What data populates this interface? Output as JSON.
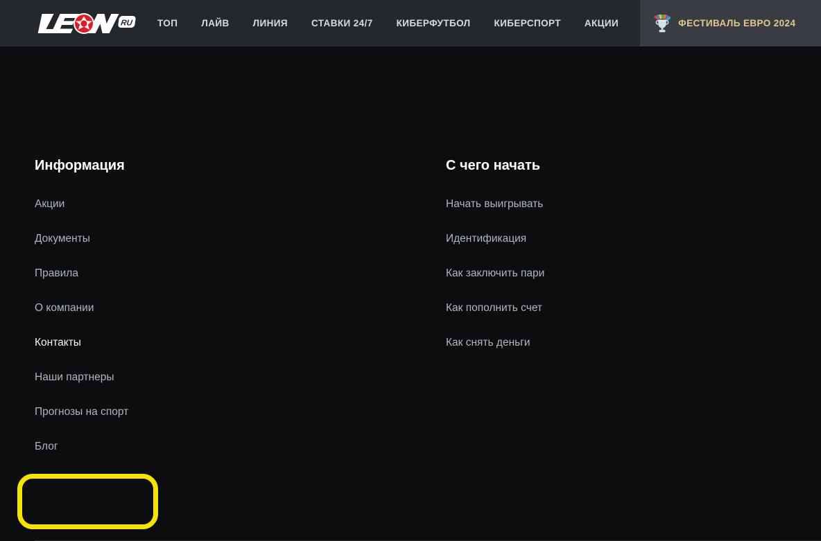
{
  "header": {
    "logo": {
      "name": "leon-ru-logo",
      "text": "LEON",
      "badge": "RU"
    },
    "nav_items": [
      {
        "label": "ТОП",
        "icon": null
      },
      {
        "label": "ЛАЙВ",
        "icon": null
      },
      {
        "label": "ЛИНИЯ",
        "icon": null
      },
      {
        "label": "СТАВКИ 24/7",
        "icon": null
      },
      {
        "label": "КИБЕРФУТБОЛ",
        "icon": null
      },
      {
        "label": "КИБЕРСПОРТ",
        "icon": null
      },
      {
        "label": "АКЦИИ",
        "icon": null
      },
      {
        "label": "ФЕСТИВАЛЬ ЕВРО 2024",
        "icon": "euro-trophy-icon"
      }
    ]
  },
  "footer": {
    "columns": [
      {
        "title": "Информация",
        "links": [
          {
            "label": "Акции",
            "state": "default"
          },
          {
            "label": "Документы",
            "state": "default"
          },
          {
            "label": "Правила",
            "state": "default"
          },
          {
            "label": "О компании",
            "state": "default"
          },
          {
            "label": "Контакты",
            "state": "active"
          },
          {
            "label": "Наши партнеры",
            "state": "default"
          },
          {
            "label": "Прогнозы на спорт",
            "state": "default"
          },
          {
            "label": "Блог",
            "state": "highlighted"
          }
        ]
      },
      {
        "title": "С чего начать",
        "links": [
          {
            "label": "Начать выигрывать",
            "state": "default"
          },
          {
            "label": "Идентификация",
            "state": "default"
          },
          {
            "label": "Как заключить пари",
            "state": "default"
          },
          {
            "label": "Как пополнить счет",
            "state": "default"
          },
          {
            "label": "Как снять деньги",
            "state": "default"
          }
        ]
      }
    ]
  },
  "colors": {
    "page_background": "#0c0d0f",
    "header_background": "#24272c",
    "festival_tab_background": "#3a3c43",
    "festival_text": "#e4c68f",
    "link_default": "#b1b5bc",
    "link_active": "#f4f6f8",
    "highlight_ring": "#f5e400",
    "logo_accent": "#e01a26"
  }
}
